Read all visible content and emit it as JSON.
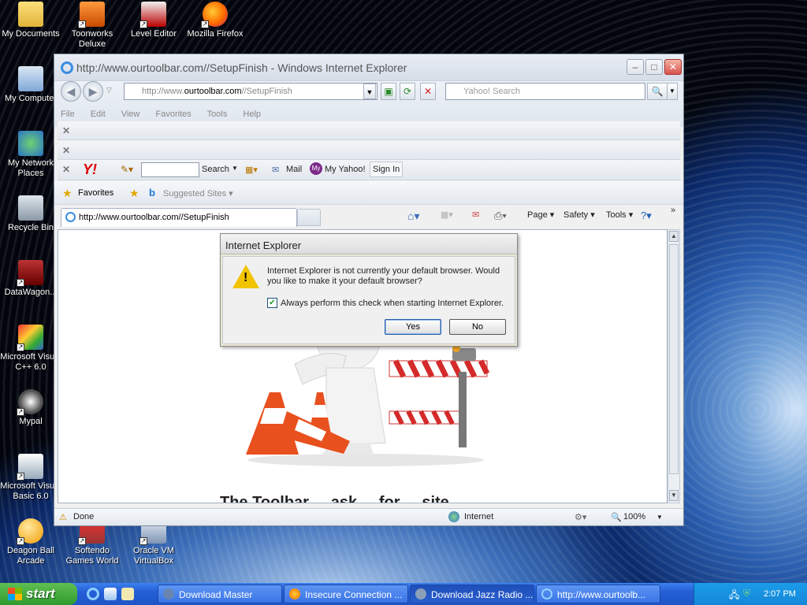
{
  "desktop": {
    "icons": [
      {
        "label": "My Documents"
      },
      {
        "label": "Toonworks Deluxe"
      },
      {
        "label": "Level Editor"
      },
      {
        "label": "Mozilla Firefox"
      },
      {
        "label": "My Computer"
      },
      {
        "label": "My Network Places"
      },
      {
        "label": "Recycle Bin"
      },
      {
        "label": "DataWagon..."
      },
      {
        "label": "Microsoft Visual C++ 6.0"
      },
      {
        "label": "Mypal"
      },
      {
        "label": "Microsoft Visual Basic 6.0"
      },
      {
        "label": "Deagon Ball Arcade"
      },
      {
        "label": "Softendo Games World"
      },
      {
        "label": "Oracle VM VirtualBox"
      }
    ]
  },
  "browser": {
    "title": "http://www.ourtoolbar.com//SetupFinish - Windows Internet Explorer",
    "address_prefix": "http://www.",
    "address_domain": "ourtoolbar.com",
    "address_suffix": "//SetupFinish",
    "search_placeholder": "Yahoo! Search",
    "menu": [
      "File",
      "Edit",
      "View",
      "Favorites",
      "Tools",
      "Help"
    ],
    "yahoo_toolbar": {
      "search_label": "Search",
      "mail_label": "Mail",
      "myyahoo_label": "My Yahoo!",
      "signin_label": "Sign In"
    },
    "favorites_label": "Favorites",
    "suggested_sites_label": "Suggested Sites",
    "tab_label": "http://www.ourtoolbar.com//SetupFinish",
    "command_bar": {
      "page_label": "Page",
      "safety_label": "Safety",
      "tools_label": "Tools"
    },
    "status": {
      "text": "Done",
      "zone": "Internet",
      "zoom": "100%"
    },
    "page_bottom_text": "The Toolbar ... ask ... for ... site"
  },
  "dialog": {
    "title": "Internet Explorer",
    "message": "Internet Explorer is not currently your default browser. Would you like to make it your default browser?",
    "checkbox_label": "Always perform this check when starting Internet Explorer.",
    "checkbox_checked": true,
    "yes_label": "Yes",
    "no_label": "No"
  },
  "taskbar": {
    "start_label": "start",
    "buttons": [
      {
        "label": "Download Master"
      },
      {
        "label": "Insecure Connection ..."
      },
      {
        "label": "Download Jazz Radio ..."
      },
      {
        "label": "http://www.ourtoolb..."
      }
    ],
    "clock": "2:07 PM"
  },
  "colors": {
    "taskbar_blue": "#245fd6",
    "start_green": "#2f9a2e",
    "warning_yellow": "#f2c400",
    "cone_orange": "#e8501e"
  }
}
